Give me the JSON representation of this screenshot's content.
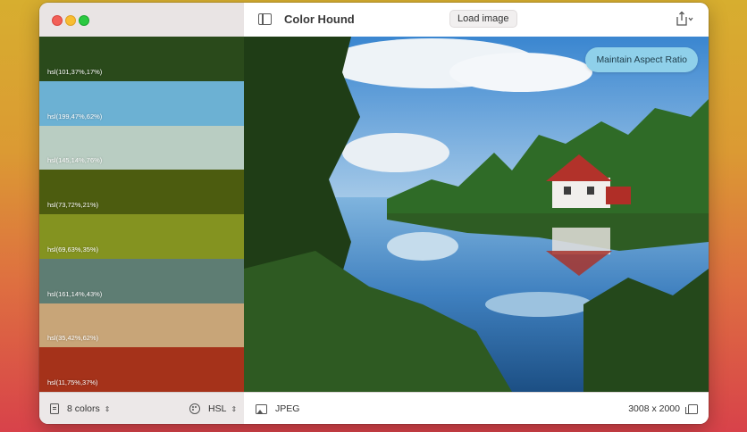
{
  "app": {
    "title": "Color Hound"
  },
  "toolbar": {
    "load_label": "Load image"
  },
  "image": {
    "aspect_label": "Maintain Aspect Ratio",
    "format": "JPEG",
    "dimensions": "3008 x 2000"
  },
  "palette": [
    {
      "label": "hsl(101,37%,17%)",
      "color": "#2a4a1b"
    },
    {
      "label": "hsl(199,47%,62%)",
      "color": "#6cb1d3"
    },
    {
      "label": "hsl(145,14%,76%)",
      "color": "#b9cdc2"
    },
    {
      "label": "hsl(73,72%,21%)",
      "color": "#4c5c0f"
    },
    {
      "label": "hsl(69,63%,35%)",
      "color": "#849320"
    },
    {
      "label": "hsl(161,14%,43%)",
      "color": "#5e7d73"
    },
    {
      "label": "hsl(35,42%,62%)",
      "color": "#c8a578"
    },
    {
      "label": "hsl(11,75%,37%)",
      "color": "#a5321a"
    }
  ],
  "footer": {
    "colors_label": "8 colors",
    "mode_label": "HSL"
  },
  "icons": [
    "sidebar-toggle-icon",
    "share-icon",
    "document-icon",
    "palette-icon",
    "image-icon",
    "copy-icon"
  ]
}
